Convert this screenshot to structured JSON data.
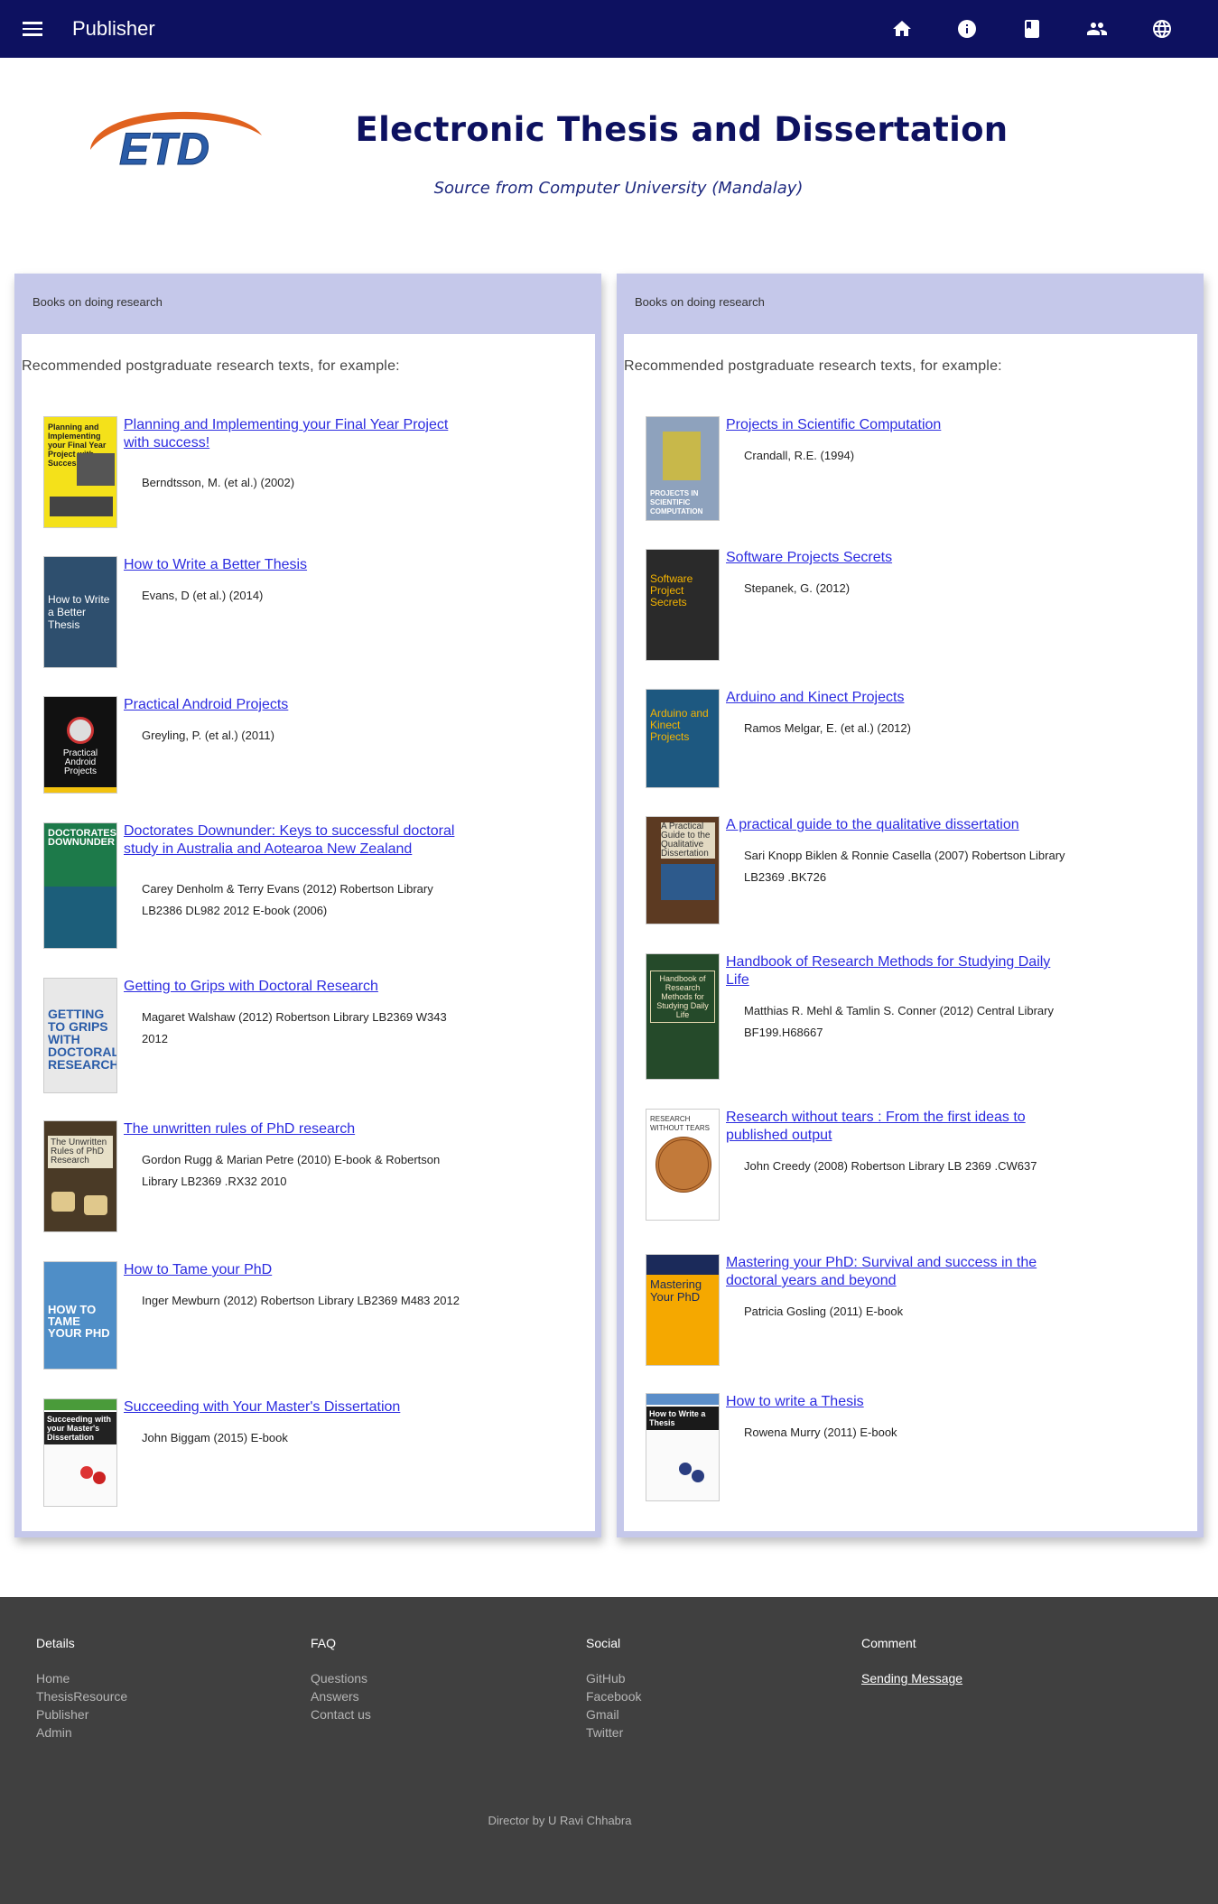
{
  "nav": {
    "brand": "Publisher",
    "icons": [
      "home-icon",
      "info-icon",
      "book-icon",
      "people-icon",
      "globe-icon"
    ]
  },
  "header": {
    "logo_text": "ETD",
    "title": "Electronic Thesis and Dissertation",
    "subtitle": "Source from Computer University (Mandalay)"
  },
  "left_panel": {
    "heading": "Books on doing research",
    "intro": "Recommended postgraduate research texts, for example:",
    "books": [
      {
        "title": "Planning and Implementing your Final Year Project with success!",
        "meta": "Berndtsson, M. (et al.) (2002)",
        "cover_text": "Planning and Implementing your Final Year Project with Success!"
      },
      {
        "title": "How to Write a Better Thesis",
        "meta": "Evans, D (et al.) (2014)",
        "cover_text": "How to Write a Better Thesis"
      },
      {
        "title": "Practical Android Projects",
        "meta": "Greyling, P. (et al.) (2011)",
        "cover_text": "Practical Android Projects"
      },
      {
        "title": "Doctorates Downunder: Keys to successful doctoral study in Australia and Aotearoa New Zealand",
        "meta": "Carey Denholm & Terry Evans (2012) Robertson Library LB2386 DL982 2012 E-book (2006)",
        "cover_text": "DOCTORATES DOWNUNDER"
      },
      {
        "title": "Getting to Grips with Doctoral Research",
        "meta": "Magaret Walshaw (2012) Robertson Library LB2369 W343 2012",
        "cover_text": "GETTING TO GRIPS WITH DOCTORAL RESEARCH"
      },
      {
        "title": "The unwritten rules of PhD research",
        "meta": "Gordon Rugg & Marian Petre (2010) E-book & Robertson Library LB2369 .RX32 2010",
        "cover_text": "The Unwritten Rules of PhD Research"
      },
      {
        "title": "How to Tame your PhD",
        "meta": "Inger Mewburn (2012) Robertson Library LB2369 M483 2012",
        "cover_text": "HOW TO TAME YOUR PHD"
      },
      {
        "title": "Succeeding with Your Master's Dissertation",
        "meta": "John Biggam (2015) E-book",
        "cover_text": "Succeeding with your Master's Dissertation"
      }
    ]
  },
  "right_panel": {
    "heading": "Books on doing research",
    "intro": "Recommended postgraduate research texts, for example:",
    "books": [
      {
        "title": "Projects in Scientific Computation",
        "meta": "Crandall, R.E. (1994)",
        "cover_text": "PROJECTS IN SCIENTIFIC COMPUTATION"
      },
      {
        "title": "Software Projects Secrets",
        "meta": "Stepanek, G. (2012)",
        "cover_text": "Software Project Secrets"
      },
      {
        "title": "Arduino and Kinect Projects",
        "meta": "Ramos Melgar, E. (et al.) (2012)",
        "cover_text": "Arduino and Kinect Projects"
      },
      {
        "title": "A practical guide to the qualitative dissertation",
        "meta": "Sari Knopp Biklen & Ronnie Casella (2007) Robertson Library LB2369 .BK726",
        "cover_text": "A Practical Guide to the Qualitative Dissertation"
      },
      {
        "title": "Handbook of Research Methods for Studying Daily Life",
        "meta": "Matthias R. Mehl & Tamlin S. Conner (2012) Central Library BF199.H68667",
        "cover_text": "Handbook of Research Methods for Studying Daily Life"
      },
      {
        "title": "Research without tears : From the first ideas to published output",
        "meta": "John Creedy (2008) Robertson Library LB 2369 .CW637",
        "cover_text": "RESEARCH WITHOUT TEARS"
      },
      {
        "title": "Mastering your PhD: Survival and success in the doctoral years and beyond",
        "meta": "Patricia Gosling (2011) E-book",
        "cover_text": "Mastering Your PhD"
      },
      {
        "title": "How to write a Thesis",
        "meta": "Rowena Murry (2011) E-book",
        "cover_text": "How to Write a Thesis"
      }
    ]
  },
  "footer": {
    "details": {
      "heading": "Details",
      "links": [
        "Home",
        "ThesisResource",
        "Publisher",
        "Admin"
      ]
    },
    "faq": {
      "heading": "FAQ",
      "links": [
        "Questions",
        "Answers",
        "Contact us"
      ]
    },
    "social": {
      "heading": "Social",
      "links": [
        "GitHub",
        "Facebook",
        "Gmail",
        "Twitter"
      ]
    },
    "comment": {
      "heading": "Comment",
      "link": "Sending Message"
    },
    "credit": "Director by U Ravi Chhabra"
  }
}
